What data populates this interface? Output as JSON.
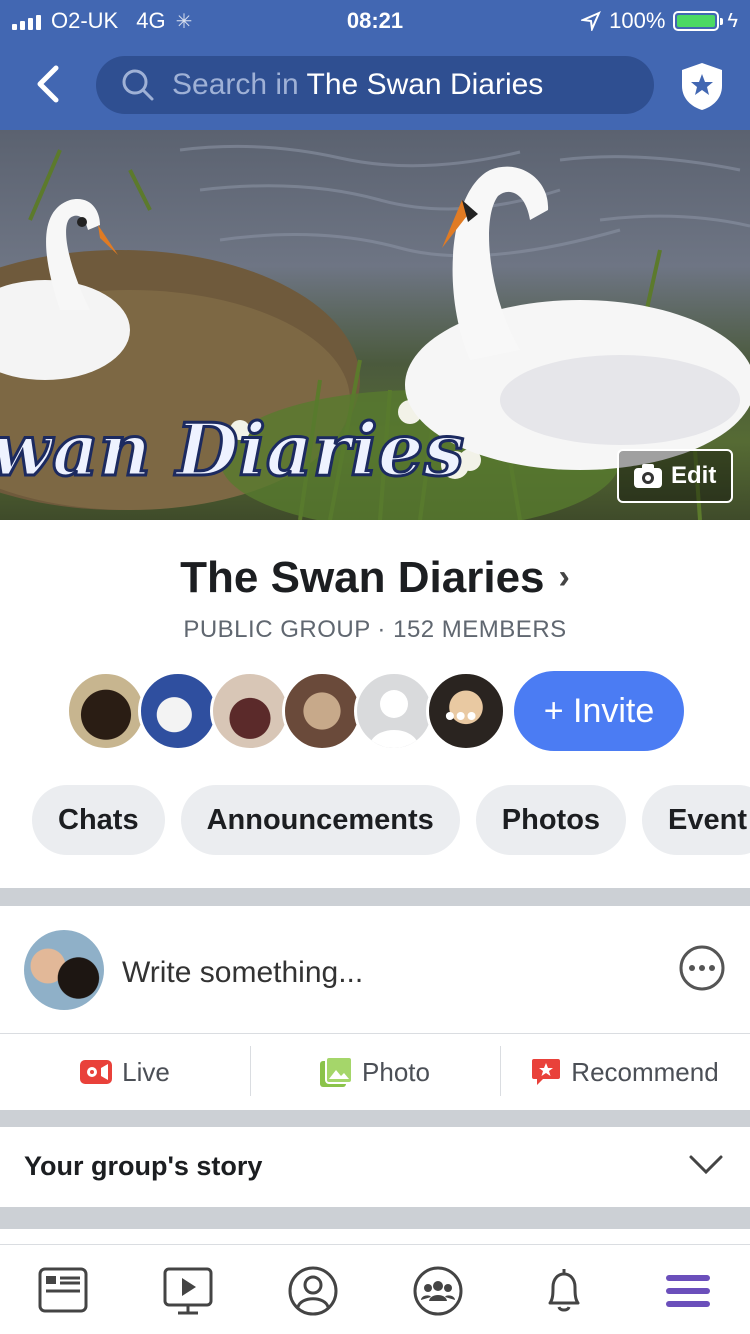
{
  "status_bar": {
    "carrier": "O2-UK",
    "network": "4G",
    "time": "08:21",
    "battery": "100%"
  },
  "header": {
    "search_placeholder": "Search in",
    "search_group": "The Swan Diaries"
  },
  "cover": {
    "overlay_text": "wan Diaries",
    "edit_label": "Edit"
  },
  "group": {
    "name": "The Swan Diaries",
    "meta": "PUBLIC GROUP · 152 MEMBERS",
    "invite_label": "+ Invite"
  },
  "tabs": [
    "Chats",
    "Announcements",
    "Photos",
    "Event"
  ],
  "composer": {
    "placeholder": "Write something..."
  },
  "actions": {
    "live": "Live",
    "photo": "Photo",
    "recommend": "Recommend"
  },
  "story": {
    "label": "Your group's story"
  },
  "colors": {
    "header_blue": "#4267b2",
    "accent_blue": "#4b7cf3",
    "active_menu_purple": "#6b4fbb"
  }
}
